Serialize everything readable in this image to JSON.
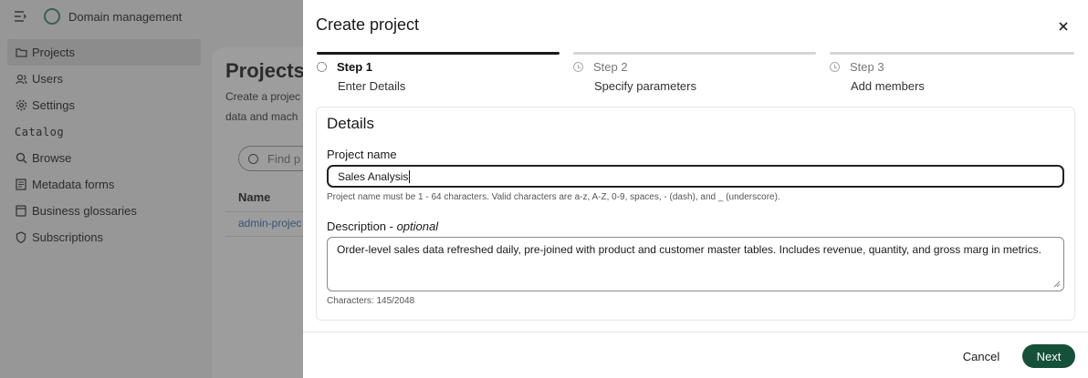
{
  "app": {
    "title": "Domain management"
  },
  "sidebar": {
    "items": [
      {
        "label": "Projects",
        "icon": "folder-icon"
      },
      {
        "label": "Users",
        "icon": "users-icon"
      },
      {
        "label": "Settings",
        "icon": "gear-icon"
      }
    ],
    "catalog_heading": "Catalog",
    "catalog_items": [
      {
        "label": "Browse",
        "icon": "search-icon"
      },
      {
        "label": "Metadata forms",
        "icon": "form-icon"
      },
      {
        "label": "Business glossaries",
        "icon": "book-icon"
      },
      {
        "label": "Subscriptions",
        "icon": "shield-icon"
      }
    ]
  },
  "content": {
    "title": "Projects",
    "desc_line1": "Create a projec",
    "desc_line2": "data and mach",
    "search_placeholder": "Find p",
    "column_name": "Name",
    "row_link": "admin-projec"
  },
  "modal": {
    "title": "Create project",
    "close_icon": "close-icon",
    "steps": [
      {
        "label": "Step 1",
        "sub": "Enter Details",
        "state": "active"
      },
      {
        "label": "Step 2",
        "sub": "Specify parameters",
        "state": "pending"
      },
      {
        "label": "Step 3",
        "sub": "Add members",
        "state": "pending"
      }
    ],
    "details_title": "Details",
    "project_name_label": "Project name",
    "project_name_value": "Sales Analysis",
    "project_name_hint": "Project name must be 1 - 64 characters. Valid characters are a-z, A-Z, 0-9, spaces, - (dash), and _ (underscore).",
    "description_label": "Description - ",
    "description_optional": "optional",
    "description_value": "Order-level sales data refreshed daily, pre-joined with product and customer master tables. Includes revenue, quantity, and gross marg in metrics.",
    "char_count": "Characters: 145/2048",
    "cancel_label": "Cancel",
    "next_label": "Next"
  },
  "colors": {
    "primary_button": "#14503a",
    "active_step": "#1a1a1a",
    "link": "#2a6fb5"
  }
}
